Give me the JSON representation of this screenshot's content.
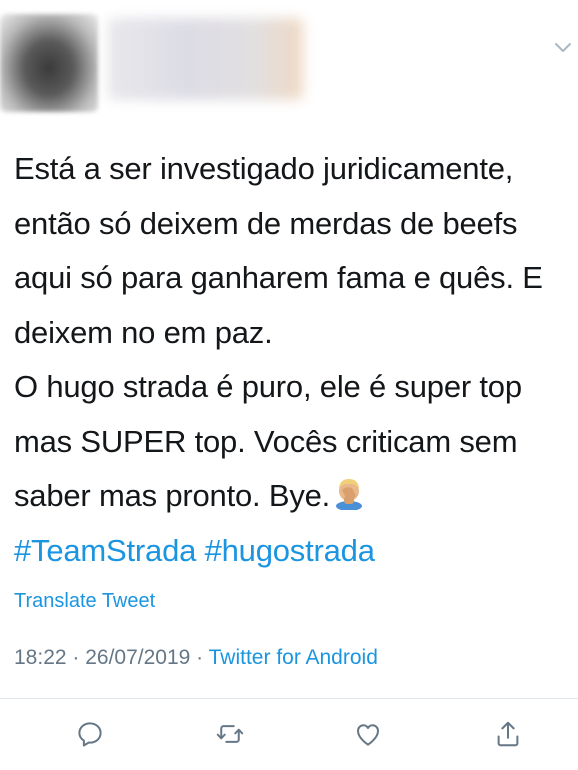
{
  "tweet": {
    "lines": [
      "Está a ser investigado juridicamente,",
      "então só deixem de merdas de beefs",
      "aqui só para ganharem fama e quês. E",
      "deixem no em paz.",
      "O hugo strada é puro, ele é super top",
      "mas SUPER top. Vocês criticam sem",
      "saber mas pronto. Bye."
    ],
    "emoji_icon": "facepalm-emoji",
    "hashtags": "#TeamStrada #hugostrada"
  },
  "translate_label": "Translate Tweet",
  "meta": {
    "time": "18:22",
    "separator1": " · ",
    "date": "26/07/2019",
    "separator2": " · ",
    "source": "Twitter for Android"
  },
  "colors": {
    "link": "#1b95e0",
    "muted": "#657786",
    "text": "#14171a"
  },
  "actions": [
    "reply-icon",
    "retweet-icon",
    "like-icon",
    "share-icon"
  ]
}
